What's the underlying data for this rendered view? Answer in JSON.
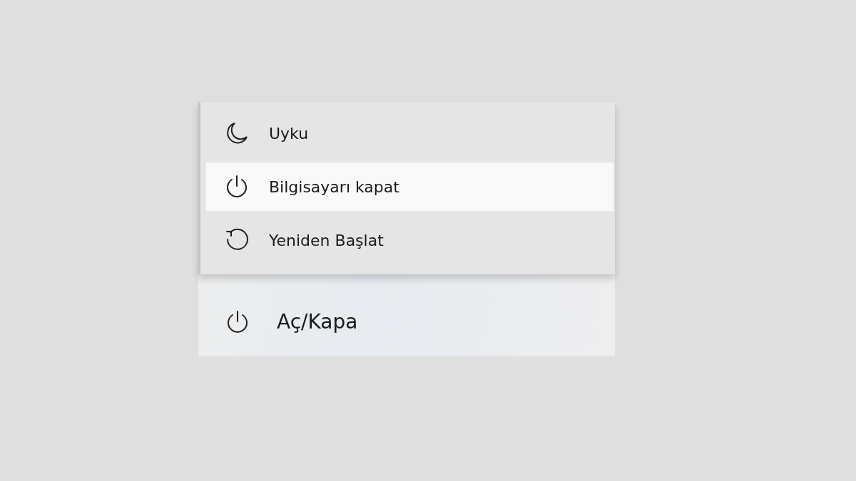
{
  "power_menu": {
    "items": [
      {
        "kind": "sleep",
        "label": "Uyku",
        "selected": false
      },
      {
        "kind": "power",
        "label": "Bilgisayarı kapat",
        "selected": true
      },
      {
        "kind": "restart",
        "label": "Yeniden Başlat",
        "selected": false
      }
    ]
  },
  "power_button": {
    "kind": "power",
    "label": "Aç/Kapa"
  }
}
